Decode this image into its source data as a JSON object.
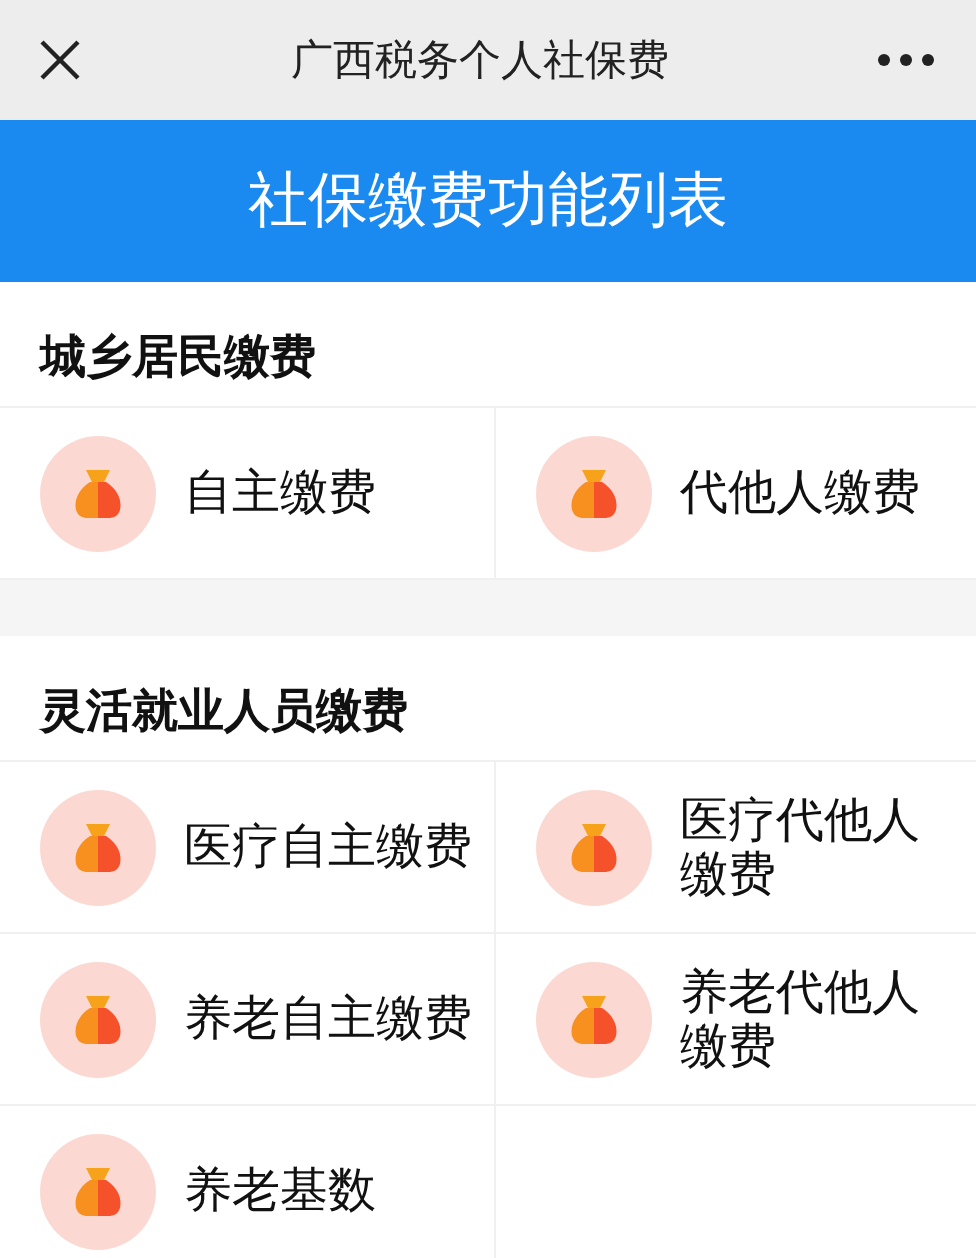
{
  "nav_bar": {
    "title": "广西税务个人社保费"
  },
  "header": {
    "title": "社保缴费功能列表"
  },
  "sections": [
    {
      "title": "城乡居民缴费",
      "items": [
        {
          "label": "自主缴费"
        },
        {
          "label": "代他人缴费"
        }
      ]
    },
    {
      "title": "灵活就业人员缴费",
      "items": [
        {
          "label": "医疗自主缴费"
        },
        {
          "label": "医疗代他人缴费"
        },
        {
          "label": "养老自主缴费"
        },
        {
          "label": "养老代他人缴费"
        },
        {
          "label": "养老基数"
        }
      ]
    }
  ]
}
